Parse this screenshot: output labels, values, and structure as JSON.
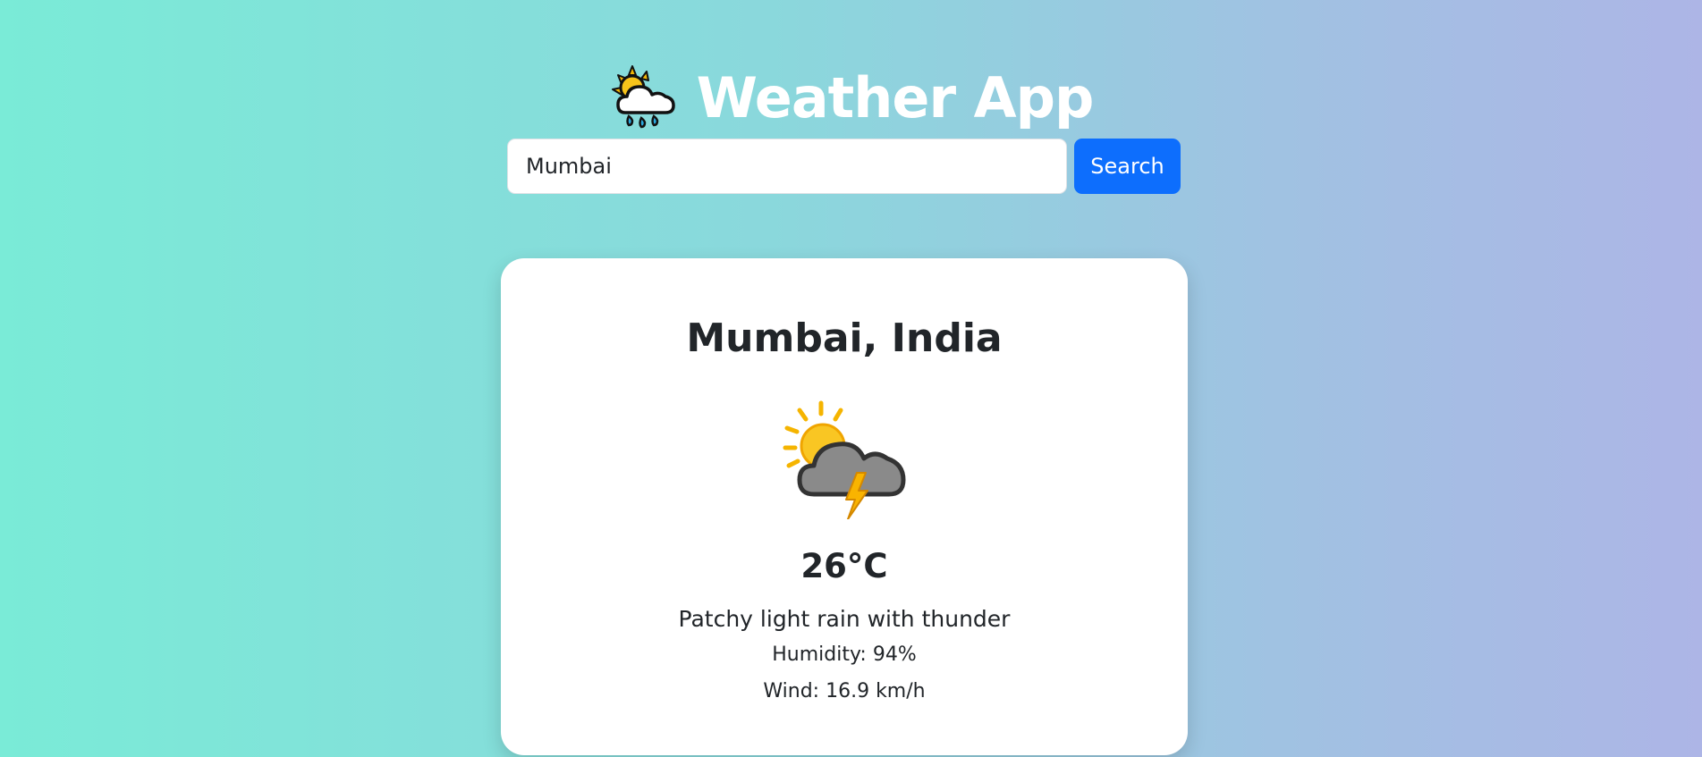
{
  "header": {
    "title": "Weather App",
    "icon": "sun-behind-rain-cloud-icon"
  },
  "search": {
    "value": "Mumbai",
    "button_label": "Search"
  },
  "weather": {
    "location": "Mumbai, India",
    "icon": "sun-cloud-lightning-icon",
    "temperature": "26°C",
    "condition": "Patchy light rain with thunder",
    "humidity": "Humidity: 94%",
    "wind": "Wind: 16.9 km/h"
  },
  "colors": {
    "background_start": "#7aebd7",
    "background_end": "#adb5e6",
    "button": "#0d6efd",
    "card": "#ffffff",
    "text": "#212529"
  }
}
